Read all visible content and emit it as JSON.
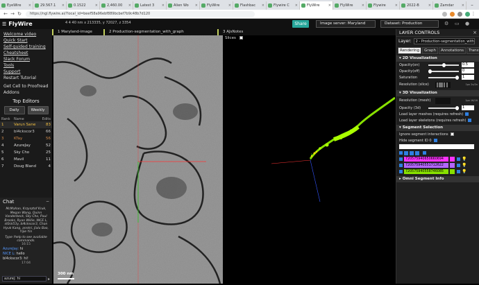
{
  "tabs": [
    {
      "label": "EyeWire"
    },
    {
      "label": "29.567.1"
    },
    {
      "label": "0.1522"
    },
    {
      "label": "2,460.00"
    },
    {
      "label": "Latest 3"
    },
    {
      "label": "Alien Wo"
    },
    {
      "label": "FlyWire"
    },
    {
      "label": "Flashbac"
    },
    {
      "label": "Flywire C"
    },
    {
      "label": "FlyWire"
    },
    {
      "label": "FlyWire"
    },
    {
      "label": "Flywire"
    },
    {
      "label": "2022-B"
    },
    {
      "label": "Zamdar"
    }
  ],
  "active_tab_label": "FlyWire",
  "url": "https://ngl.flywire.ai/?local_id=beef58a96ebf889bcbef7b9c48b7d120",
  "app": {
    "logo": "FlyWire",
    "coords": "4 4 40 nm   x 213335, y 72027, z 3354",
    "share_label": "Share",
    "image_server": "Image server: Maryland",
    "dataset": "Dataset: Production"
  },
  "sidebar": {
    "links": [
      "Welcome video",
      "Quick Start",
      "Self-guided training",
      "Cheatsheet",
      "Slack Forum",
      "Tools",
      "Support"
    ],
    "plain": [
      "Restart Tutorial",
      "Get Cell to Proofread",
      "Addons"
    ],
    "editors_title": "Top Editors",
    "tab_daily": "Daily",
    "tab_weekly": "Weekly",
    "header": {
      "rank": "Rank",
      "name": "Name",
      "edits": "Edits"
    },
    "rows": [
      {
        "rank": "1",
        "name": "Varun Sane",
        "edits": "83"
      },
      {
        "rank": "2",
        "name": "bl4ckscor3",
        "edits": "66"
      },
      {
        "rank": "3",
        "name": "KTay",
        "edits": "56"
      },
      {
        "rank": "4",
        "name": "AzureJay",
        "edits": "52"
      },
      {
        "rank": "5",
        "name": "Sky Cho",
        "edits": "25"
      },
      {
        "rank": "6",
        "name": "Mavil",
        "edits": "11"
      },
      {
        "rank": "7",
        "name": "Doug Bland",
        "edits": "4"
      }
    ]
  },
  "chat": {
    "title": "Chat",
    "system": "McMahan, Krzysztof Kruk, Megan Wang, Quinn Vanderbeck, Sky Cho, Paul Brooks, Ryan Willie, NICE L, st0ck53y, bl4ckscor3, Chan Hyuk Kang, annkri, Jialu Bao, Yijie Yin",
    "help": "Type !help to see available commands.",
    "t1": "16:15",
    "m1_user": "AzureJay:",
    "m1_text": "hi",
    "m2_user": "NICE L:",
    "m2_text": "hello",
    "m3": "bl4ckscor3: hi!",
    "t2": "17:04",
    "input": "azurej: hi"
  },
  "panels": {
    "tab1": "1  Maryland-image",
    "tab2": "2  Production-segmentation_with_graph",
    "tab3": "3  AJsNotes",
    "slices_label": "Slices",
    "scale_bar": "300 nm"
  },
  "layer_controls": {
    "title": "LAYER CONTROLS",
    "layer_label": "Layer:",
    "layer_value": "2 - Production-segmentation_with_graph",
    "tabs": [
      "Rendering",
      "Graph",
      "Annotations",
      "Transform"
    ],
    "sec_2d": "2D Visualization",
    "opacity_on": "Opacity(on)",
    "opacity_on_val": "0.5",
    "opacity_off": "Opacity(off)",
    "opacity_off_val": "0",
    "saturation": "Saturation",
    "saturation_val": "1",
    "resolution_slice": "Resolution (slice)",
    "res_slice_note": "1px 2x/2x",
    "sec_3d": "3D Visualization",
    "resolution_mesh": "Resolution (mesh)",
    "res_mesh_note": "1px 16/16",
    "opacity_3d": "Opacity (3d)",
    "opacity_3d_val": "1",
    "mesh_req": "Load layer meshes (requires refresh)",
    "skel_req": "Load layer skeletons (requires refresh)",
    "sec_seg": "Segment Selection",
    "ignore_int": "Ignore segment interactions",
    "hide_seg": "Hide segment ID 0",
    "seg_ids": [
      "720575940650660694",
      "720575940551712622",
      "720575940558746085"
    ],
    "seg_colors": [
      "#ff33ff",
      "#b366ff",
      "#88e000"
    ],
    "sec_omni": "Omni Segment Info"
  }
}
